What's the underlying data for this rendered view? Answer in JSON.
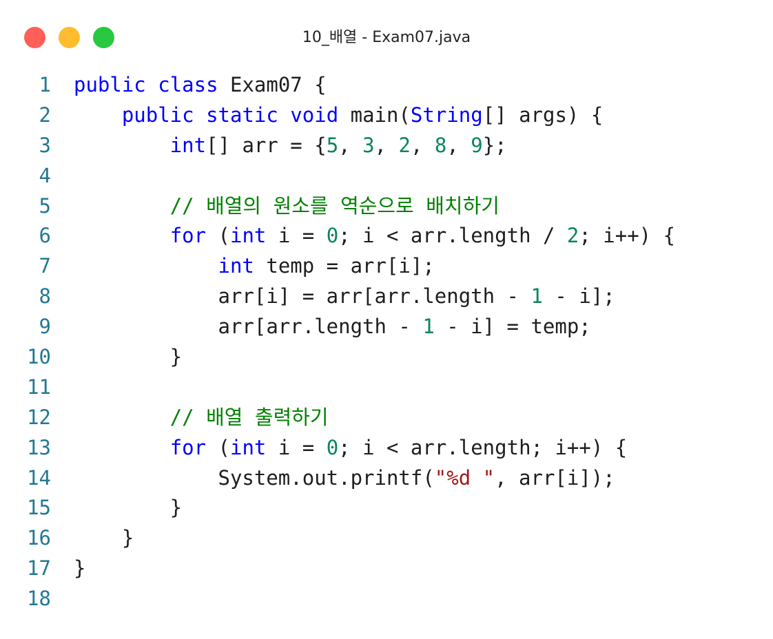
{
  "window": {
    "title": "10_배열 - Exam07.java",
    "buttons": {
      "close_color": "#ff5f57",
      "minimize_color": "#febc2e",
      "maximize_color": "#28c840"
    }
  },
  "theme": {
    "keyword": "#0000ff",
    "number": "#098658",
    "string": "#a31515",
    "comment": "#008000",
    "line_number": "#237893",
    "text": "#1e1e1e"
  },
  "editor": {
    "lines": [
      [
        {
          "t": "kw",
          "v": "public"
        },
        {
          "t": "p",
          "v": " "
        },
        {
          "t": "kw",
          "v": "class"
        },
        {
          "t": "p",
          "v": " Exam07 {"
        }
      ],
      [
        {
          "t": "p",
          "v": "    "
        },
        {
          "t": "kw",
          "v": "public"
        },
        {
          "t": "p",
          "v": " "
        },
        {
          "t": "kw",
          "v": "static"
        },
        {
          "t": "p",
          "v": " "
        },
        {
          "t": "kw",
          "v": "void"
        },
        {
          "t": "p",
          "v": " main("
        },
        {
          "t": "kw",
          "v": "String"
        },
        {
          "t": "p",
          "v": "[] args) {"
        }
      ],
      [
        {
          "t": "p",
          "v": "        "
        },
        {
          "t": "kw",
          "v": "int"
        },
        {
          "t": "p",
          "v": "[] arr = {"
        },
        {
          "t": "num",
          "v": "5"
        },
        {
          "t": "p",
          "v": ", "
        },
        {
          "t": "num",
          "v": "3"
        },
        {
          "t": "p",
          "v": ", "
        },
        {
          "t": "num",
          "v": "2"
        },
        {
          "t": "p",
          "v": ", "
        },
        {
          "t": "num",
          "v": "8"
        },
        {
          "t": "p",
          "v": ", "
        },
        {
          "t": "num",
          "v": "9"
        },
        {
          "t": "p",
          "v": "};"
        }
      ],
      [],
      [
        {
          "t": "p",
          "v": "        "
        },
        {
          "t": "cm",
          "v": "// 배열의 원소를 역순으로 배치하기"
        }
      ],
      [
        {
          "t": "p",
          "v": "        "
        },
        {
          "t": "kw",
          "v": "for"
        },
        {
          "t": "p",
          "v": " ("
        },
        {
          "t": "kw",
          "v": "int"
        },
        {
          "t": "p",
          "v": " i = "
        },
        {
          "t": "num",
          "v": "0"
        },
        {
          "t": "p",
          "v": "; i < arr.length / "
        },
        {
          "t": "num",
          "v": "2"
        },
        {
          "t": "p",
          "v": "; i++) {"
        }
      ],
      [
        {
          "t": "p",
          "v": "            "
        },
        {
          "t": "kw",
          "v": "int"
        },
        {
          "t": "p",
          "v": " temp = arr[i];"
        }
      ],
      [
        {
          "t": "p",
          "v": "            arr[i] = arr[arr.length - "
        },
        {
          "t": "num",
          "v": "1"
        },
        {
          "t": "p",
          "v": " - i];"
        }
      ],
      [
        {
          "t": "p",
          "v": "            arr[arr.length - "
        },
        {
          "t": "num",
          "v": "1"
        },
        {
          "t": "p",
          "v": " - i] = temp;"
        }
      ],
      [
        {
          "t": "p",
          "v": "        }"
        }
      ],
      [],
      [
        {
          "t": "p",
          "v": "        "
        },
        {
          "t": "cm",
          "v": "// 배열 출력하기"
        }
      ],
      [
        {
          "t": "p",
          "v": "        "
        },
        {
          "t": "kw",
          "v": "for"
        },
        {
          "t": "p",
          "v": " ("
        },
        {
          "t": "kw",
          "v": "int"
        },
        {
          "t": "p",
          "v": " i = "
        },
        {
          "t": "num",
          "v": "0"
        },
        {
          "t": "p",
          "v": "; i < arr.length; i++) {"
        }
      ],
      [
        {
          "t": "p",
          "v": "            System.out.printf("
        },
        {
          "t": "str",
          "v": "\"%d \""
        },
        {
          "t": "p",
          "v": ", arr[i]);"
        }
      ],
      [
        {
          "t": "p",
          "v": "        }"
        }
      ],
      [
        {
          "t": "p",
          "v": "    }"
        }
      ],
      [
        {
          "t": "p",
          "v": "}"
        }
      ],
      []
    ]
  }
}
